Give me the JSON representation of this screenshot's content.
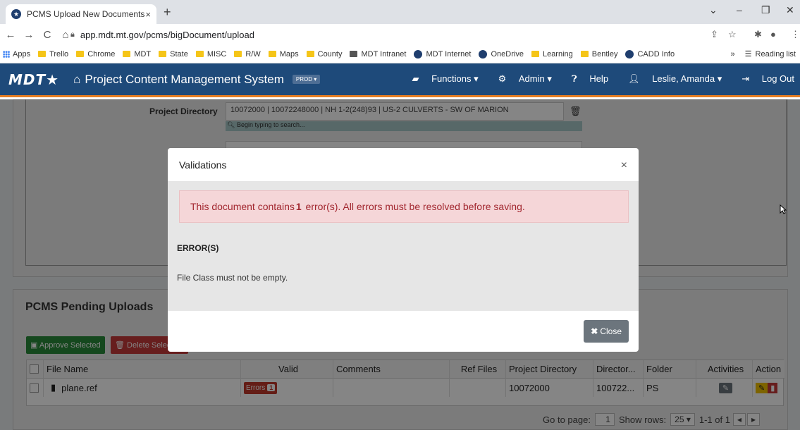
{
  "browser": {
    "tab_title": "PCMS Upload New Documents",
    "tab_close": "×",
    "new_tab": "+",
    "url": "app.mdt.mt.gov/pcms/bigDocument/upload",
    "bookmarks": [
      {
        "label": "Apps",
        "icon": "apps"
      },
      {
        "label": "Trello",
        "icon": "folder"
      },
      {
        "label": "Chrome",
        "icon": "folder"
      },
      {
        "label": "MDT",
        "icon": "folder"
      },
      {
        "label": "State",
        "icon": "folder"
      },
      {
        "label": "MISC",
        "icon": "folder"
      },
      {
        "label": "R/W",
        "icon": "folder"
      },
      {
        "label": "Maps",
        "icon": "folder"
      },
      {
        "label": "County",
        "icon": "folder"
      },
      {
        "label": "MDT Intranet",
        "icon": "site"
      },
      {
        "label": "MDT Internet",
        "icon": "round"
      },
      {
        "label": "OneDrive",
        "icon": "round"
      },
      {
        "label": "Learning",
        "icon": "folder"
      },
      {
        "label": "Bentley",
        "icon": "folder"
      },
      {
        "label": "CADD Info",
        "icon": "round"
      }
    ],
    "more_bookmarks": "»",
    "reading_list": "Reading list"
  },
  "app": {
    "logo": "MDT★",
    "title": "Project Content Management System",
    "env_badge": "PROD ▾",
    "nav": {
      "functions": "Functions ▾",
      "admin": "Admin ▾",
      "help": "Help",
      "user": "Leslie, Amanda ▾",
      "logout": "Log Out"
    }
  },
  "form": {
    "project_directory_label": "Project Directory",
    "project_directory_value": "10072000 | 10072248000 | NH 1-2(248)93 | US-2 CULVERTS - SW OF MARION",
    "search_hint": "Begin typing to search..."
  },
  "pending": {
    "title": "PCMS Pending Uploads",
    "approve_label": "Approve Selected",
    "delete_label": "Delete Selec",
    "columns": [
      "File Name",
      "Valid",
      "Comments",
      "Ref Files",
      "Project Directory",
      "Director...",
      "Folder",
      "Activities",
      "Action"
    ],
    "row": {
      "file_name": "plane.ref",
      "valid": "Errors",
      "error_count": "1",
      "comments": "",
      "ref_files": "",
      "project_directory": "10072000",
      "directory": "100722...",
      "folder": "PS"
    },
    "pager": {
      "go_to_label": "Go to page:",
      "page": "1",
      "show_rows_label": "Show rows:",
      "rows": "25",
      "range": "1-1 of 1"
    }
  },
  "modal": {
    "title": "Validations",
    "close_x": "×",
    "alert_before": "This document contains ",
    "alert_count": "1",
    "alert_after": " error(s). All errors must be resolved before saving.",
    "errors_heading": "ERROR(S)",
    "error_message": "File Class must not be empty.",
    "close_label": "Close"
  },
  "colors": {
    "appbar": "#1e4a7a",
    "accent": "#e67e22",
    "alert_bg": "#f5d6d8",
    "alert_text": "#a2272f",
    "approve": "#2a8a3a",
    "delete": "#c63a3a"
  }
}
